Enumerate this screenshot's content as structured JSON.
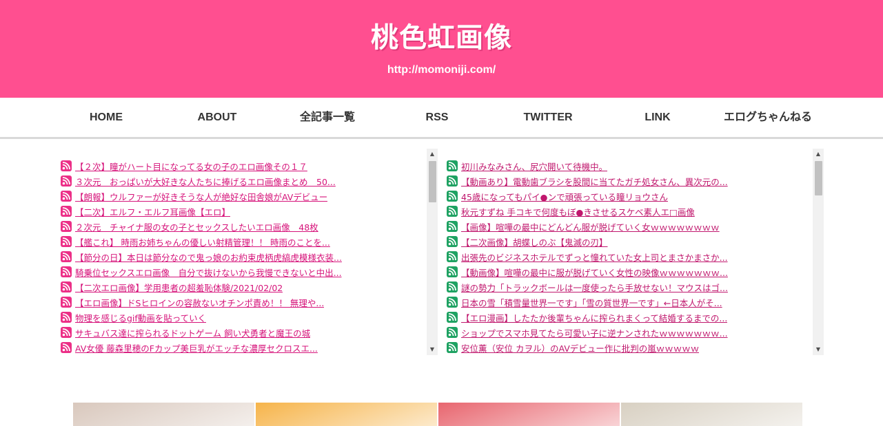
{
  "header": {
    "logo_text": "桃色虹画像",
    "site_url": "http://momoniji.com/",
    "bg_color": "#ff4f90"
  },
  "nav": {
    "items": [
      "HOME",
      "ABOUT",
      "全記事一覧",
      "RSS",
      "TWITTER",
      "LINK",
      "エログちゃんねる"
    ]
  },
  "left_feed": {
    "icon": "rss-feed-icon",
    "icon_color": "#ec2f87",
    "items": [
      "【２次】瞳がハート目になってる女の子のエロ画像その１７",
      "３次元　おっぱいが大好きな人たちに捧げるエロ画像まとめ　50...",
      "【朗報】ウルファーが好きそうな人が絶好な田舎娘がAVデビュー",
      "【二次】エルフ・エルフ耳画像【エロ】",
      "２次元　チャイナ服の女の子とセックスしたいエロ画像　48枚",
      "【艦これ】 時雨お姉ちゃんの優しい射精管理！！ 時雨のことを...",
      "【節分の日】本日は節分なので鬼っ娘のお約束虎柄虎縞虎模様衣装...",
      "騎乗位セックスエロ画像　自分で抜けないから我慢できないと中出...",
      "【二次エロ画像】学用患者の超羞恥体験/2021/02/02",
      "【エロ画像】ドSヒロインの容赦ないオチンポ責め！！ 無理や...",
      "物理を感じるgif動画を貼っていく",
      "サキュバス達に搾られるドットゲーム 飼い犬勇者と魔王の城",
      "AV女優 藤森里穂のFカップ美巨乳がエッチな濃厚セクロスエ..."
    ]
  },
  "right_feed": {
    "icon": "rss-feed-icon",
    "icon_color": "#1ea262",
    "items": [
      "初川みなみさん、尻穴開いて待機中。",
      "【動画あり】電動歯ブラシを股間に当てたガチ処女さん、異次元の...",
      "45歳になってもパイ●ンで頑張っている瞳リョウさん",
      "秋元すずね 手コキで何度もぼ●きさせるスケベ素人エ□画像",
      "【画像】喧嘩の最中にどんどん服が脱げていく女ｗｗｗｗｗｗｗｗ",
      "【二次画像】胡蝶しのぶ【鬼滅の刃】",
      "出張先のビジネスホテルでずっと憧れていた女上司とまさかまさか...",
      "【動画像】喧嘩の最中に服が脱げていく女性の映像ｗｗｗｗｗｗｗ...",
      "謎の勢力「トラックボールは一度使ったら手放せない！マウスはゴ...",
      "日本の雪「積雪量世界一です」「雪の質世界一です」←日本人がそ...",
      "【エロ漫画】したたか後輩ちゃんに搾られまくって結婚するまでの...",
      "ショップでスマホ見てたら可愛い子に逆ナンされたｗｗｗｗｗｗｗ...",
      "安位薫（安位 カヲル）のAVデビュー作に批判の嵐ｗｗｗｗｗ"
    ]
  },
  "scrollbar": {
    "up_glyph": "▲",
    "down_glyph": "▼"
  },
  "thumbnails": {
    "colors": [
      "#d9c8bd",
      "#f6b44a",
      "#e8666f",
      "#d8d0c2"
    ]
  }
}
